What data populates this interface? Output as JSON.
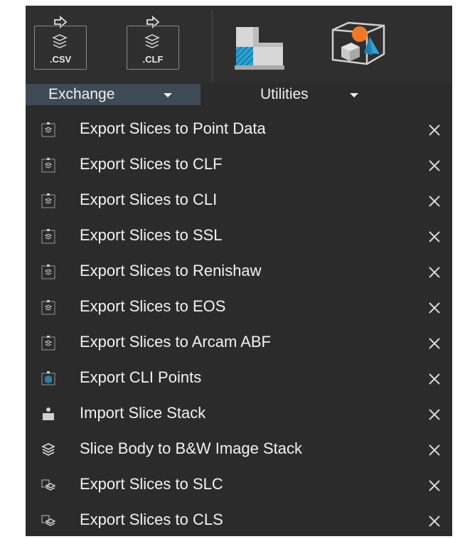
{
  "toolbar": {
    "buttons": [
      {
        "ext": ".CSV",
        "name": "export-csv-button"
      },
      {
        "ext": ".CLF",
        "name": "export-clf-button"
      }
    ],
    "icons": [
      "slice-profile-icon",
      "3d-shapes-box-icon"
    ]
  },
  "groups": {
    "exchange_label": "Exchange",
    "utilities_label": "Utilities"
  },
  "menu": {
    "items": [
      {
        "label": "Export Slices to Point Data",
        "icon": "export-slices-csv-icon"
      },
      {
        "label": "Export Slices to CLF",
        "icon": "export-slices-clf-icon"
      },
      {
        "label": "Export Slices to CLI",
        "icon": "export-slices-cli-icon"
      },
      {
        "label": "Export Slices to SSL",
        "icon": "export-slices-ssl-icon"
      },
      {
        "label": "Export Slices to Renishaw",
        "icon": "export-slices-renishaw-icon"
      },
      {
        "label": "Export Slices to EOS",
        "icon": "export-slices-eos-icon"
      },
      {
        "label": "Export Slices to Arcam ABF",
        "icon": "export-slices-arcam-icon"
      },
      {
        "label": "Export CLI Points",
        "icon": "export-cli-points-icon"
      },
      {
        "label": "Import Slice Stack",
        "icon": "import-slice-stack-icon"
      },
      {
        "label": "Slice Body to B&W Image Stack",
        "icon": "image-stack-icon"
      },
      {
        "label": "Export Slices to SLC",
        "icon": "export-slices-slc-icon"
      },
      {
        "label": "Export Slices to CLS",
        "icon": "export-slices-cls-icon"
      }
    ]
  },
  "colors": {
    "panel_bg": "#2b2b2b",
    "active_tab_bg": "#3e4a55",
    "text": "#f2f2f2",
    "accent_blue": "#29a3d8",
    "accent_orange": "#f07a23"
  }
}
